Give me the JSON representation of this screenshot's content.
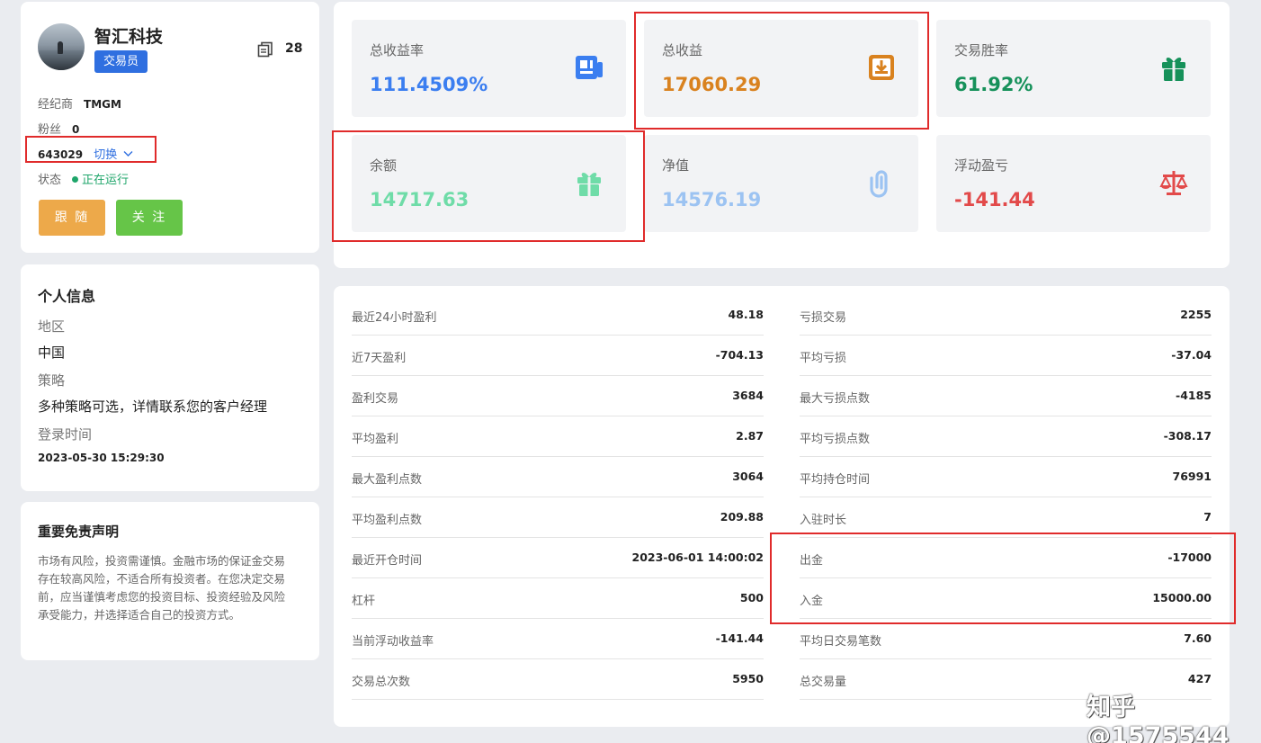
{
  "profile": {
    "name": "智汇科技",
    "role": "交易员",
    "doc_count": "28",
    "broker_label": "经纪商",
    "broker_value": "TMGM",
    "fans_label": "粉丝",
    "fans_value": "0",
    "account": "643029",
    "switch_label": "切换",
    "status_label": "状态",
    "status_value": "正在运行",
    "follow_btn": "跟 随",
    "watch_btn": "关 注"
  },
  "personal": {
    "title": "个人信息",
    "region_label": "地区",
    "region_value": "中国",
    "strategy_label": "策略",
    "strategy_value": "多种策略可选，详情联系您的客户经理",
    "login_label": "登录时间",
    "login_value": "2023-05-30 15:29:30"
  },
  "disclaimer": {
    "title": "重要免责声明",
    "text": "市场有风险，投资需谨慎。金融市场的保证金交易存在较高风险，不适合所有投资者。在您决定交易前，应当谨慎考虑您的投资目标、投资经验及风险承受能力，并选择适合自己的投资方式。"
  },
  "stats": [
    {
      "label": "总收益率",
      "value": "111.4509%",
      "color": "#3b7ef0",
      "icon": "news-icon"
    },
    {
      "label": "总收益",
      "value": "17060.29",
      "color": "#d9821f",
      "icon": "download-box-icon"
    },
    {
      "label": "交易胜率",
      "value": "61.92%",
      "color": "#16915a",
      "icon": "gift-icon"
    },
    {
      "label": "余额",
      "value": "14717.63",
      "color": "#6fdca8",
      "icon": "gift-icon"
    },
    {
      "label": "净值",
      "value": "14576.19",
      "color": "#9cc3f2",
      "icon": "paperclip-icon"
    },
    {
      "label": "浮动盈亏",
      "value": "-141.44",
      "color": "#e24a4a",
      "icon": "scale-icon"
    }
  ],
  "details_left": [
    {
      "label": "最近24小时盈利",
      "value": "48.18"
    },
    {
      "label": "近7天盈利",
      "value": "-704.13"
    },
    {
      "label": "盈利交易",
      "value": "3684"
    },
    {
      "label": "平均盈利",
      "value": "2.87"
    },
    {
      "label": "最大盈利点数",
      "value": "3064"
    },
    {
      "label": "平均盈利点数",
      "value": "209.88"
    },
    {
      "label": "最近开仓时间",
      "value": "2023-06-01 14:00:02"
    },
    {
      "label": "杠杆",
      "value": "500"
    },
    {
      "label": "当前浮动收益率",
      "value": "-141.44"
    },
    {
      "label": "交易总次数",
      "value": "5950"
    }
  ],
  "details_right": [
    {
      "label": "亏损交易",
      "value": "2255"
    },
    {
      "label": "平均亏损",
      "value": "-37.04"
    },
    {
      "label": "最大亏损点数",
      "value": "-4185"
    },
    {
      "label": "平均亏损点数",
      "value": "-308.17"
    },
    {
      "label": "平均持仓时间",
      "value": "76991"
    },
    {
      "label": "入驻时长",
      "value": "7"
    },
    {
      "label": "出金",
      "value": "-17000"
    },
    {
      "label": "入金",
      "value": "15000.00"
    },
    {
      "label": "平均日交易笔数",
      "value": "7.60"
    },
    {
      "label": "总交易量",
      "value": "427"
    }
  ],
  "watermark": "知乎 @1575544"
}
